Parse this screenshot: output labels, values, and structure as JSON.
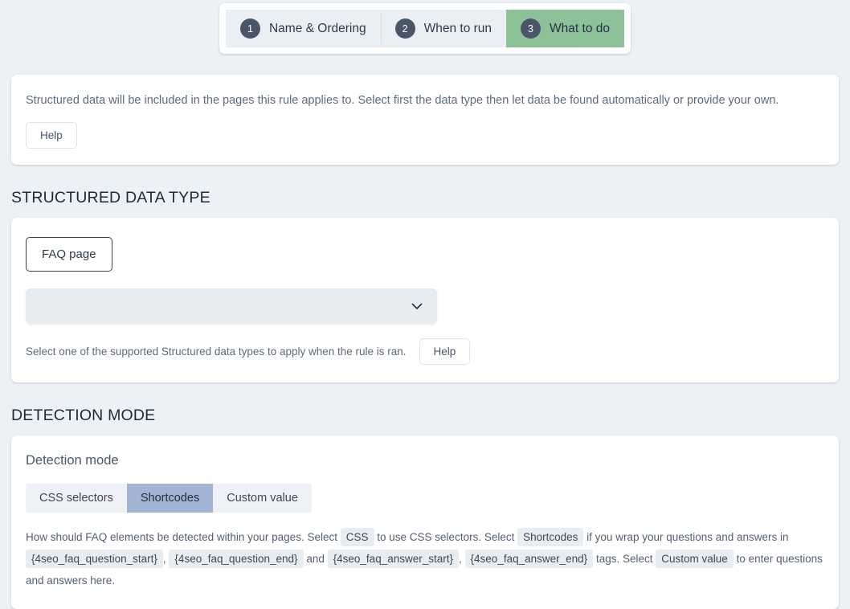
{
  "wizard": {
    "steps": [
      {
        "num": "1",
        "label": "Name & Ordering",
        "active": false
      },
      {
        "num": "2",
        "label": "When to run",
        "active": false
      },
      {
        "num": "3",
        "label": "What to do",
        "active": true
      }
    ],
    "active_color": "#8cc194",
    "num_badge_color": "#4a5568"
  },
  "notice": {
    "text": "Structured data will be included in the pages this rule applies to. Select first the data type then let data be found automatically or provide your own.",
    "help_label": "Help"
  },
  "structured_data_type": {
    "section_title": "STRUCTURED DATA TYPE",
    "tab_label": "FAQ page",
    "select_value": "",
    "select_placeholder": "",
    "chevron_icon": "chevron-down-icon",
    "hint": "Select one of the supported Structured data types to apply when the rule is ran.",
    "help_label": "Help"
  },
  "detection_mode": {
    "section_title": "DETECTION MODE",
    "card_title": "Detection mode",
    "options": [
      {
        "label": "CSS selectors",
        "selected": false
      },
      {
        "label": "Shortcodes",
        "selected": true
      },
      {
        "label": "Custom value",
        "selected": false
      }
    ],
    "selected_color": "#a3b3d4",
    "description": [
      {
        "type": "text",
        "value": "How should FAQ elements be detected within your pages. Select"
      },
      {
        "type": "chip",
        "value": "CSS"
      },
      {
        "type": "text",
        "value": "to use CSS selectors. Select"
      },
      {
        "type": "chip",
        "value": "Shortcodes"
      },
      {
        "type": "text",
        "value": "if you wrap your questions and answers in"
      },
      {
        "type": "chip",
        "value": "{4seo_faq_question_start}"
      },
      {
        "type": "text",
        "value": ","
      },
      {
        "type": "chip",
        "value": "{4seo_faq_question_end}"
      },
      {
        "type": "text",
        "value": "and"
      },
      {
        "type": "chip",
        "value": "{4seo_faq_answer_start}"
      },
      {
        "type": "text",
        "value": ","
      },
      {
        "type": "chip",
        "value": "{4seo_faq_answer_end}"
      },
      {
        "type": "text",
        "value": "tags. Select"
      },
      {
        "type": "chip",
        "value": "Custom value"
      },
      {
        "type": "text",
        "value": "to enter questions and answers here."
      }
    ]
  }
}
